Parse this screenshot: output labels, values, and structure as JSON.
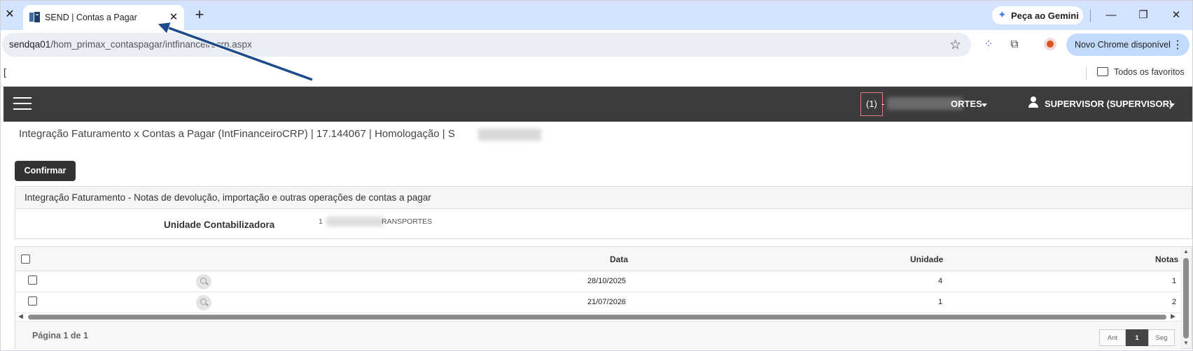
{
  "browser": {
    "tab_title": "SEND | Contas a Pagar",
    "new_tab_symbol": "+",
    "gemini_label": "Peça ao Gemini",
    "url_host": "sendqa01",
    "url_path": "/hom_primax_contaspagar/intfinanceirocrp.aspx",
    "update_label": "Novo Chrome disponível",
    "bookmarks_left": "[",
    "bookmarks_all": "Todos os favoritos"
  },
  "app": {
    "company_number": "(1)",
    "company_dash": "-",
    "company_name_visible": "ORTES",
    "user": "SUPERVISOR (SUPERVISOR)",
    "page_title": "Integração Faturamento x Contas a Pagar (IntFinanceiroCRP) | 17.144067 | Homologação | S",
    "confirm_label": "Confirmar",
    "panel_title": "Integração Faturamento - Notas de devolução, importação e outras operações de contas a pagar",
    "field_label": "Unidade Contabilizadora",
    "field_value_prefix": "1",
    "field_value_suffix": "RANSPORTES"
  },
  "grid": {
    "columns": [
      "Data",
      "Unidade",
      "Notas"
    ],
    "rows": [
      {
        "data": "28/10/2025",
        "unidade": "4",
        "notas": "1"
      },
      {
        "data": "21/07/2026",
        "unidade": "1",
        "notas": "2"
      }
    ],
    "page_info": "Página 1 de 1",
    "pager": {
      "prev": "Ant",
      "current": "1",
      "next": "Seg"
    }
  }
}
